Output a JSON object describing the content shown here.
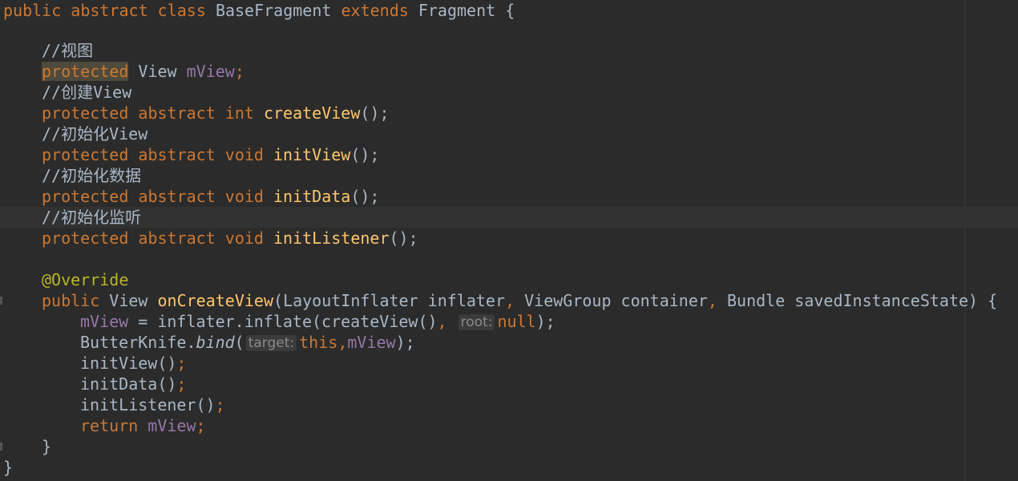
{
  "code": {
    "class_decl": {
      "public": "public",
      "abstract": "abstract",
      "class": "class",
      "class_name": "BaseFragment",
      "extends": "extends",
      "super_name": "Fragment",
      "brace": "{"
    },
    "comment_view": "//视图",
    "field_line": {
      "modifier": "protected",
      "type": "View",
      "name": "mView",
      "semicolon": ";"
    },
    "comment_create": "//创建View",
    "method_create": {
      "modifier": "protected",
      "abstract": "abstract",
      "ret": "int",
      "name": "createView",
      "tail": "();"
    },
    "comment_init_view": "//初始化View",
    "method_init_view": {
      "modifier": "protected",
      "abstract": "abstract",
      "ret": "void",
      "name": "initView",
      "tail": "();"
    },
    "comment_init_data": "//初始化数据",
    "method_init_data": {
      "modifier": "protected",
      "abstract": "abstract",
      "ret": "void",
      "name": "initData",
      "tail": "();"
    },
    "comment_init_listener": "//初始化监听",
    "method_init_listener": {
      "modifier": "protected",
      "abstract": "abstract",
      "ret": "void",
      "name": "initListener",
      "tail": "();"
    },
    "annotation": "@Override",
    "on_create_view": {
      "public": "public",
      "ret": "View",
      "name": "onCreateView",
      "open_paren": "(",
      "p1_type": "LayoutInflater",
      "p1_name": "inflater",
      "comma1": ",",
      "p2_type": "ViewGroup",
      "p2_name": "container",
      "comma2": ",",
      "p3_type": "Bundle",
      "p3_name": "savedInstanceState",
      "close": ") {"
    },
    "assign_line": {
      "field": "mView",
      "eq": " = inflater.inflate(createView()",
      "comma": ",",
      "hint": "root:",
      "null_kw": "null",
      "end": ");"
    },
    "bind_line": {
      "cls": "ButterKnife.",
      "method": "bind",
      "paren": "(",
      "hint": "target:",
      "this_kw": "this",
      "comma": ",",
      "field": "mView",
      "end": ");"
    },
    "call_init_view": {
      "name": "initView()",
      "semi": ";"
    },
    "call_init_data": {
      "name": "initData()",
      "semi": ";"
    },
    "call_init_listener": {
      "name": "initListener()",
      "semi": ";"
    },
    "return_line": {
      "kw": "return",
      "field": "mView",
      "semi": ";"
    },
    "method_close": "}",
    "class_close": "}"
  }
}
